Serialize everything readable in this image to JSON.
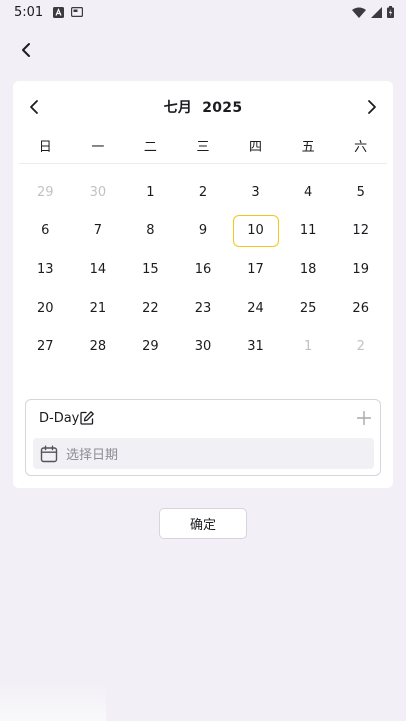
{
  "status_bar": {
    "time": "5:01",
    "left_icons": [
      "app-a-icon",
      "card-icon"
    ],
    "right_icons": [
      "wifi-icon",
      "signal-icon",
      "battery-icon"
    ]
  },
  "header": {
    "back_icon": "chevron-left-icon"
  },
  "calendar": {
    "month": "七月",
    "year": "2025",
    "prev_icon": "chevron-left-icon",
    "next_icon": "chevron-right-icon",
    "weekdays": [
      "日",
      "一",
      "二",
      "三",
      "四",
      "五",
      "六"
    ],
    "days": [
      {
        "label": "29",
        "muted": true
      },
      {
        "label": "30",
        "muted": true
      },
      {
        "label": "1"
      },
      {
        "label": "2"
      },
      {
        "label": "3"
      },
      {
        "label": "4"
      },
      {
        "label": "5"
      },
      {
        "label": "6"
      },
      {
        "label": "7"
      },
      {
        "label": "8"
      },
      {
        "label": "9"
      },
      {
        "label": "10",
        "today": true
      },
      {
        "label": "11"
      },
      {
        "label": "12"
      },
      {
        "label": "13"
      },
      {
        "label": "14"
      },
      {
        "label": "15"
      },
      {
        "label": "16"
      },
      {
        "label": "17"
      },
      {
        "label": "18"
      },
      {
        "label": "19"
      },
      {
        "label": "20"
      },
      {
        "label": "21"
      },
      {
        "label": "22"
      },
      {
        "label": "23"
      },
      {
        "label": "24"
      },
      {
        "label": "25"
      },
      {
        "label": "26"
      },
      {
        "label": "27"
      },
      {
        "label": "28"
      },
      {
        "label": "29"
      },
      {
        "label": "30"
      },
      {
        "label": "31"
      },
      {
        "label": "1",
        "muted": true
      },
      {
        "label": "2",
        "muted": true
      }
    ],
    "highlight_color": "#f2c71a"
  },
  "dday": {
    "label": "D-Day",
    "edit_icon": "edit-icon",
    "add_icon": "plus-icon",
    "date_placeholder": "选择日期",
    "calendar_icon": "calendar-icon"
  },
  "footer": {
    "confirm_label": "确定"
  }
}
